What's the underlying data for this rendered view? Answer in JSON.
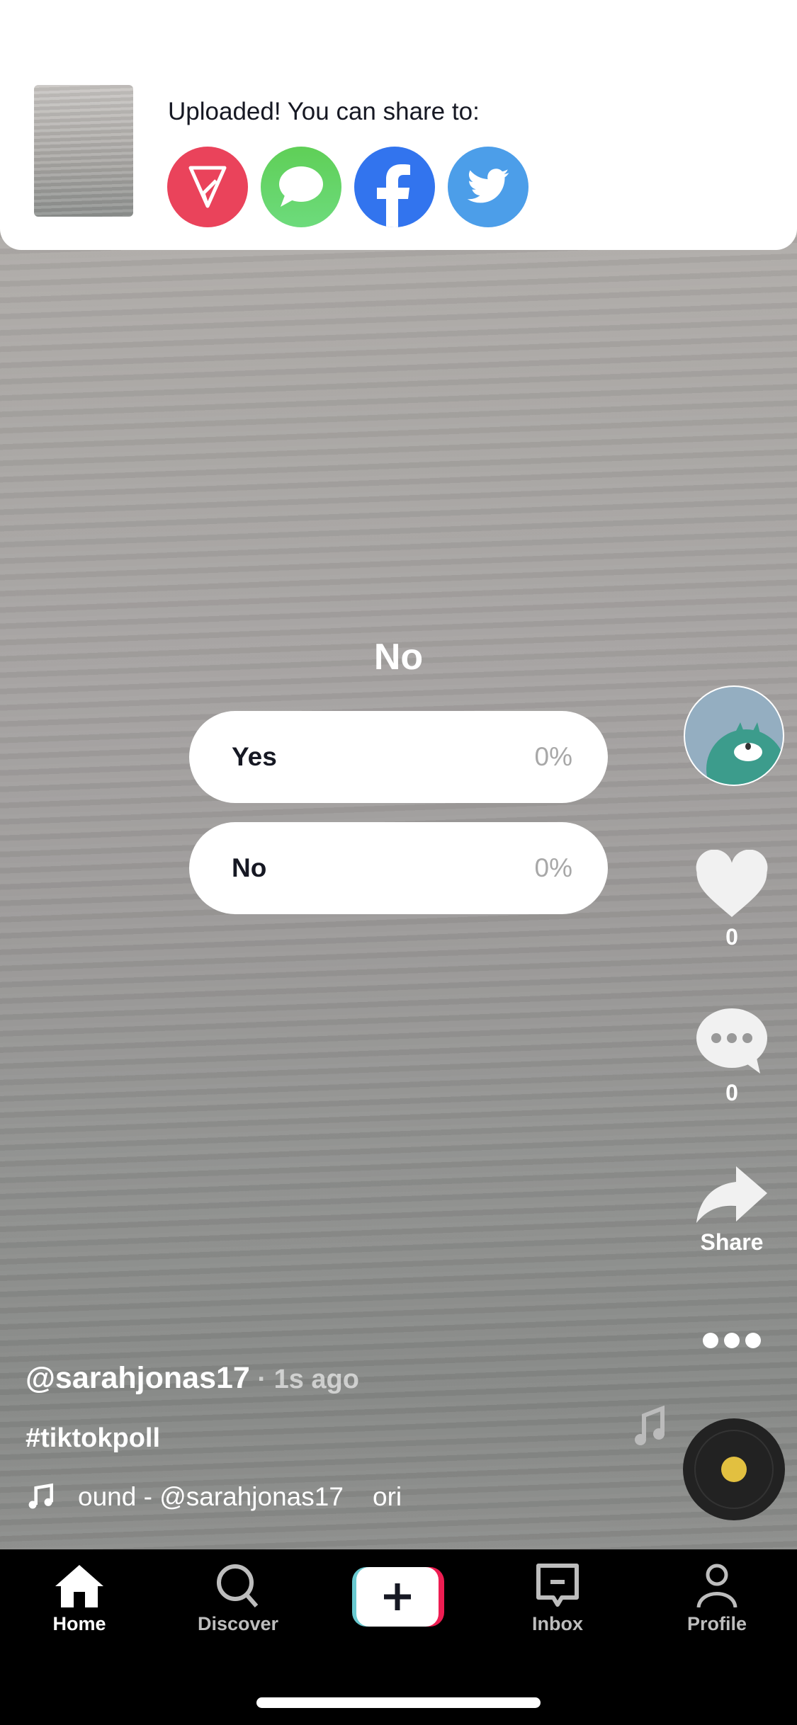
{
  "banner": {
    "message": "Uploaded! You can share to:",
    "targets": [
      {
        "name": "TikTok Direct",
        "color": "#EA435B"
      },
      {
        "name": "Messages",
        "color": "#64D165"
      },
      {
        "name": "Facebook",
        "color": "#3274EE"
      },
      {
        "name": "Twitter",
        "color": "#4C9EE9"
      }
    ]
  },
  "poll": {
    "question": "No",
    "options": [
      {
        "label": "Yes",
        "percent": "0%"
      },
      {
        "label": "No",
        "percent": "0%"
      }
    ]
  },
  "rail": {
    "likes": "0",
    "comments": "0",
    "share_label": "Share"
  },
  "post": {
    "username": "@sarahjonas17",
    "time": " · 1s ago",
    "caption": "#tiktokpoll",
    "sound": "ound - @sarahjonas17    ori"
  },
  "nav": {
    "home": "Home",
    "discover": "Discover",
    "inbox": "Inbox",
    "profile": "Profile"
  }
}
